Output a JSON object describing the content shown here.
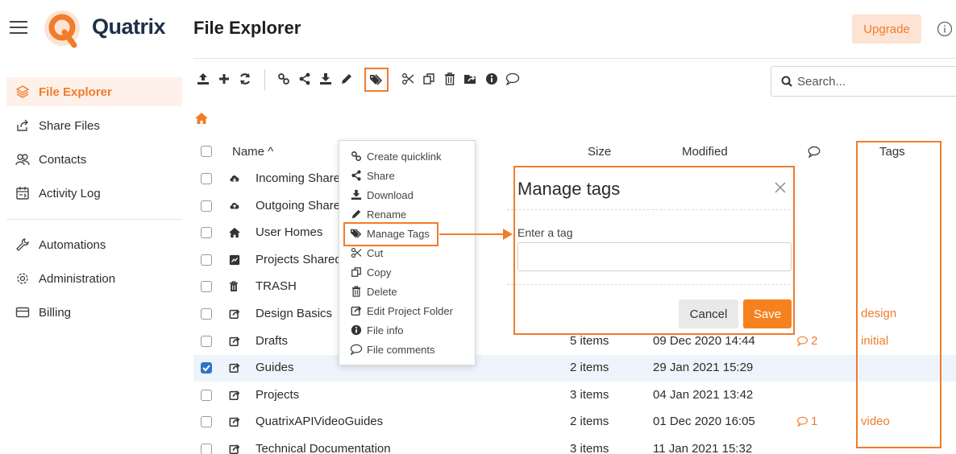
{
  "header": {
    "logo_text": "Quatrix",
    "title": "File Explorer",
    "upgrade_label": "Upgrade"
  },
  "sidebar": {
    "items": [
      {
        "label": "File Explorer",
        "icon": "layers-icon"
      },
      {
        "label": "Share Files",
        "icon": "share-arrow-icon"
      },
      {
        "label": "Contacts",
        "icon": "users-icon"
      },
      {
        "label": "Activity Log",
        "icon": "calendar-log-icon"
      },
      {
        "label": "Automations",
        "icon": "wrench-icon"
      },
      {
        "label": "Administration",
        "icon": "gear-icon"
      },
      {
        "label": "Billing",
        "icon": "credit-card-icon"
      }
    ]
  },
  "search": {
    "placeholder": "Search..."
  },
  "table": {
    "headers": {
      "name": "Name ^",
      "size": "Size",
      "modified": "Modified",
      "tags": "Tags"
    },
    "rows": [
      {
        "name": "Incoming Shares",
        "size": "",
        "modified": "",
        "comments": "",
        "tags": "",
        "icon": "cloud-download-icon",
        "checked": false
      },
      {
        "name": "Outgoing Shares",
        "size": "",
        "modified": "",
        "comments": "",
        "tags": "",
        "icon": "cloud-upload-icon",
        "checked": false
      },
      {
        "name": "User Homes",
        "size": "",
        "modified": "",
        "comments": "",
        "tags": "",
        "icon": "home-icon",
        "checked": false
      },
      {
        "name": "Projects Shared",
        "size": "",
        "modified": "",
        "comments": "",
        "tags": "",
        "icon": "shared-folder-icon",
        "checked": false
      },
      {
        "name": "TRASH",
        "size": "",
        "modified": "",
        "comments": "",
        "tags": "",
        "icon": "trash-icon",
        "checked": false
      },
      {
        "name": "Design Basics",
        "size": "",
        "modified": "",
        "comments": "",
        "tags": "design",
        "icon": "project-folder-icon",
        "checked": false
      },
      {
        "name": "Drafts",
        "size": "5 items",
        "modified": "09 Dec 2020 14:44",
        "comments": "2",
        "tags": "initial",
        "icon": "project-folder-icon",
        "checked": false
      },
      {
        "name": "Guides",
        "size": "2 items",
        "modified": "29 Jan 2021 15:29",
        "comments": "",
        "tags": "",
        "icon": "project-folder-icon",
        "checked": true
      },
      {
        "name": "Projects",
        "size": "3 items",
        "modified": "04 Jan 2021 13:42",
        "comments": "",
        "tags": "",
        "icon": "project-folder-icon",
        "checked": false
      },
      {
        "name": "QuatrixAPIVideoGuides",
        "size": "2 items",
        "modified": "01 Dec 2020 16:05",
        "comments": "1",
        "tags": "video",
        "icon": "project-folder-icon",
        "checked": false
      },
      {
        "name": "Technical Documentation",
        "size": "3 items",
        "modified": "11 Jan 2021 15:32",
        "comments": "",
        "tags": "",
        "icon": "project-folder-icon",
        "checked": false
      }
    ]
  },
  "context_menu": {
    "items": [
      {
        "label": "Create quicklink",
        "icon": "link-icon"
      },
      {
        "label": "Share",
        "icon": "share-icon"
      },
      {
        "label": "Download",
        "icon": "download-icon"
      },
      {
        "label": "Rename",
        "icon": "pencil-icon"
      },
      {
        "label": "Manage Tags",
        "icon": "tags-icon"
      },
      {
        "label": "Cut",
        "icon": "scissors-icon"
      },
      {
        "label": "Copy",
        "icon": "copy-icon"
      },
      {
        "label": "Delete",
        "icon": "trash-icon"
      },
      {
        "label": "Edit Project Folder",
        "icon": "project-folder-icon"
      },
      {
        "label": "File info",
        "icon": "info-icon"
      },
      {
        "label": "File comments",
        "icon": "comment-icon"
      }
    ]
  },
  "modal": {
    "title": "Manage tags",
    "label": "Enter a tag",
    "input_value": "",
    "cancel_label": "Cancel",
    "save_label": "Save"
  },
  "colors": {
    "accent": "#f07c2c",
    "accent_light": "#fde3d3",
    "selected_row": "#eef4fb",
    "checkbox_checked": "#2f74c6",
    "logo_dark": "#1e3047"
  }
}
